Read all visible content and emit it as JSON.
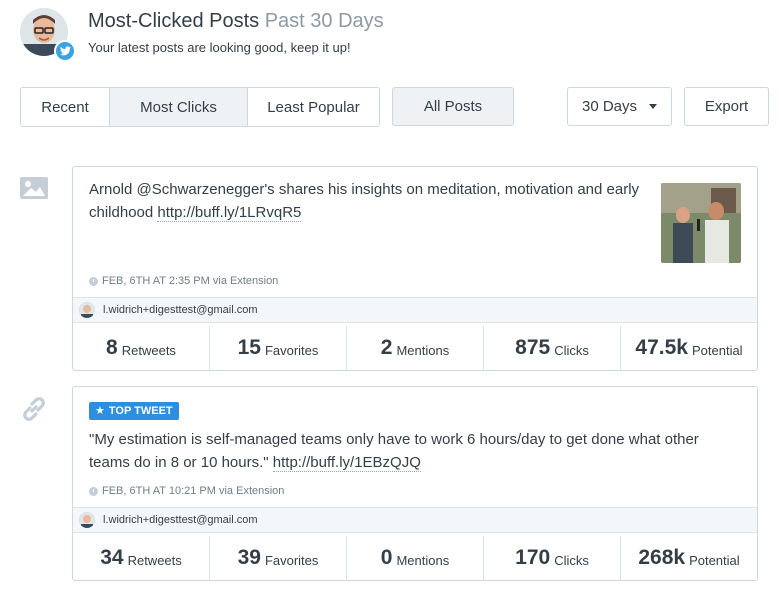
{
  "header": {
    "title": "Most-Clicked Posts",
    "range": "Past 30 Days",
    "subtitle": "Your latest posts are looking good, keep it up!",
    "profile_icon": "profile-avatar",
    "network_icon": "twitter-icon"
  },
  "toolbar": {
    "tabs": [
      {
        "label": "Recent",
        "active": false
      },
      {
        "label": "Most Clicks",
        "active": true
      },
      {
        "label": "Least Popular",
        "active": false
      }
    ],
    "filter_label": "All Posts",
    "period_label": "30 Days",
    "export_label": "Export"
  },
  "posts": [
    {
      "type_icon": "image-icon",
      "text_before": "Arnold @Schwarzenegger's shares his insights on meditation, motivation and early childhood ",
      "link": "http://buff.ly/1LRvqR5",
      "text_after": "",
      "time": "FEB, 6TH AT 2:35 PM",
      "via": "via Extension",
      "account": "l.widrich+digesttest@gmail.com",
      "stats": [
        {
          "value": "8",
          "label": "Retweets"
        },
        {
          "value": "15",
          "label": "Favorites"
        },
        {
          "value": "2",
          "label": "Mentions"
        },
        {
          "value": "875",
          "label": "Clicks"
        },
        {
          "value": "47.5k",
          "label": "Potential"
        }
      ]
    },
    {
      "type_icon": "link-icon",
      "badge": "TOP TWEET",
      "text_before": "\"My estimation is self-managed teams only have to work 6 hours/day to get done what other teams do in 8 or 10 hours.\" ",
      "link": "http://buff.ly/1EBzQJQ",
      "text_after": "",
      "time": "FEB, 6TH AT 10:21 PM",
      "via": "via Extension",
      "account": "l.widrich+digesttest@gmail.com",
      "stats": [
        {
          "value": "34",
          "label": "Retweets"
        },
        {
          "value": "39",
          "label": "Favorites"
        },
        {
          "value": "0",
          "label": "Mentions"
        },
        {
          "value": "170",
          "label": "Clicks"
        },
        {
          "value": "268k",
          "label": "Potential"
        }
      ]
    }
  ],
  "colors": {
    "accent": "#2d8fe0",
    "twitter": "#3ca3e3",
    "border": "#ced7df",
    "muted": "#8d9aa4"
  }
}
